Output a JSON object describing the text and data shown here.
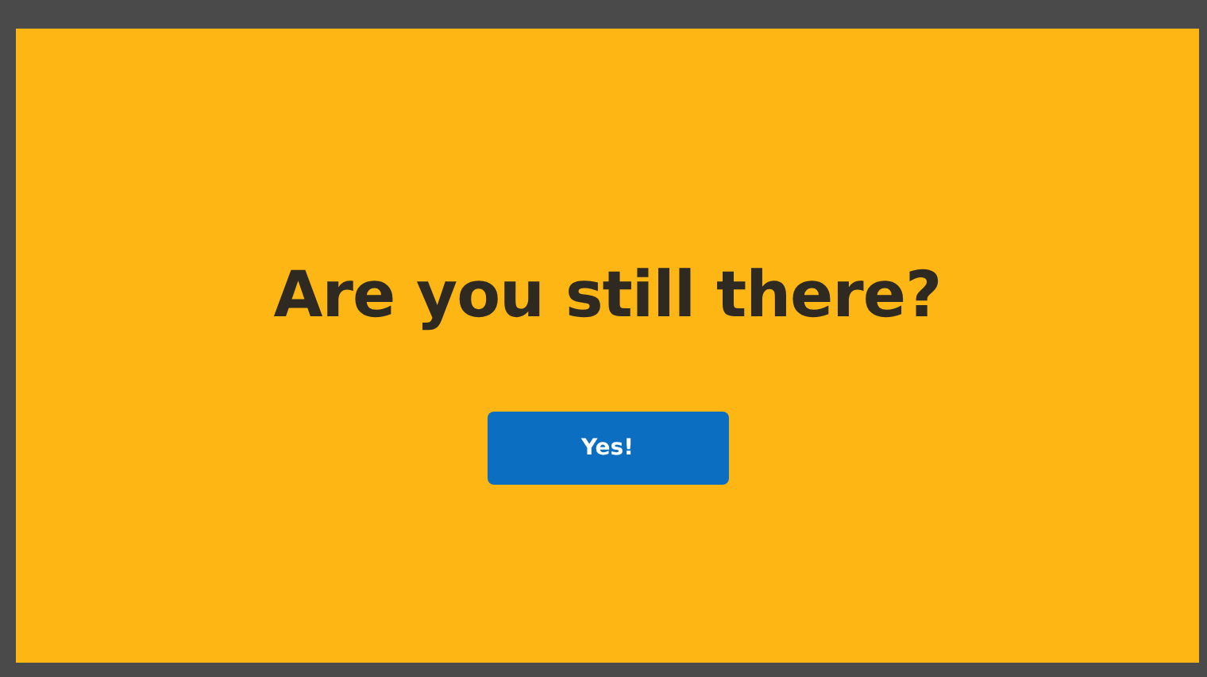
{
  "dialog": {
    "heading": "Are you still there?",
    "buttons": [
      {
        "label": "Yes!",
        "kind": "primary"
      }
    ]
  }
}
